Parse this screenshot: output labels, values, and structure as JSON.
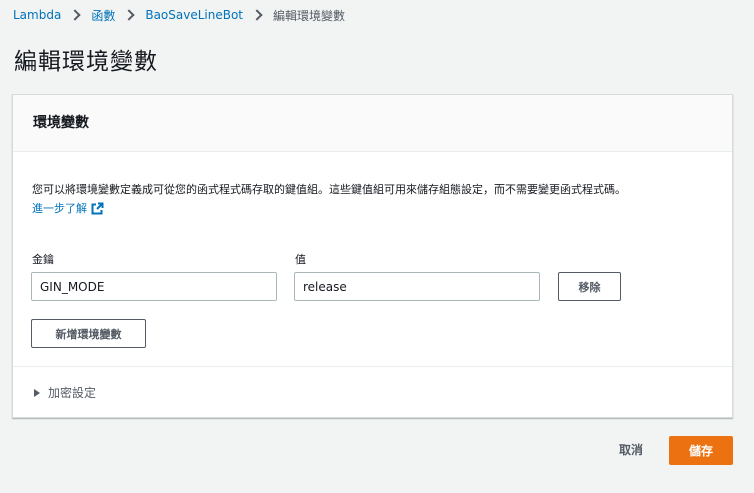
{
  "breadcrumb": {
    "items": [
      "Lambda",
      "函數",
      "BaoSaveLineBot"
    ],
    "current": "編輯環境變數"
  },
  "page_title": "編輯環境變數",
  "panel": {
    "title": "環境變數",
    "description": "您可以將環境變數定義成可從您的函式程式碼存取的鍵值組。這些鍵值組可用來儲存組態設定，而不需要變更函式程式碼。",
    "learn_more": "進一步了解",
    "key_label": "金鑰",
    "value_label": "值",
    "variables": [
      {
        "key": "GIN_MODE",
        "value": "release",
        "remove_label": "移除"
      }
    ],
    "add_button": "新增環境變數",
    "encryption_label": "加密設定"
  },
  "footer": {
    "cancel": "取消",
    "save": "儲存"
  },
  "colors": {
    "link": "#0073bb",
    "primary": "#ec7211",
    "background": "#f2f3f3"
  }
}
